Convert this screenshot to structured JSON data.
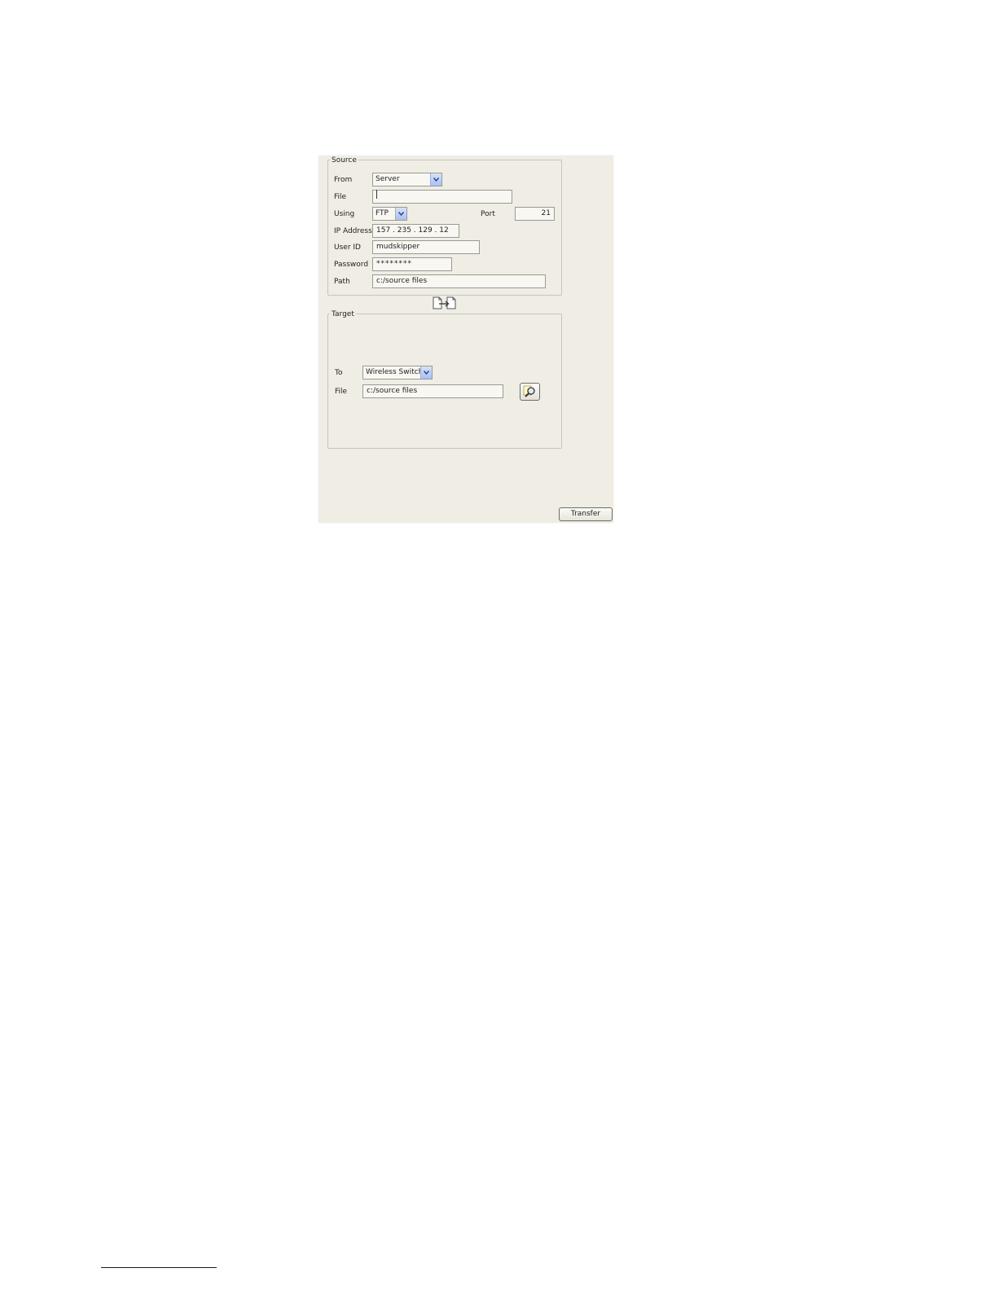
{
  "source": {
    "legend": "Source",
    "from_label": "From",
    "from_value": "Server",
    "file_label": "File",
    "file_value": "",
    "using_label": "Using",
    "using_value": "FTP",
    "port_label": "Port",
    "port_value": "21",
    "ip_label": "IP Address",
    "ip_value": "157 . 235 . 129 . 12",
    "userid_label": "User ID",
    "userid_value": "mudskipper",
    "password_label": "Password",
    "password_value": "********",
    "path_label": "Path",
    "path_value": "c:/source files"
  },
  "target": {
    "legend": "Target",
    "to_label": "To",
    "to_value": "Wireless Switch",
    "file_label": "File",
    "file_value": "c:/source files"
  },
  "actions": {
    "transfer_label": "Transfer"
  },
  "icons": {
    "transfer_direction": "file-transfer-icon",
    "browse": "magnifier-icon",
    "dropdown": "chevron-down-icon"
  },
  "colors": {
    "panel_bg": "#efede4",
    "dropdown_button": "#aac0ee"
  }
}
